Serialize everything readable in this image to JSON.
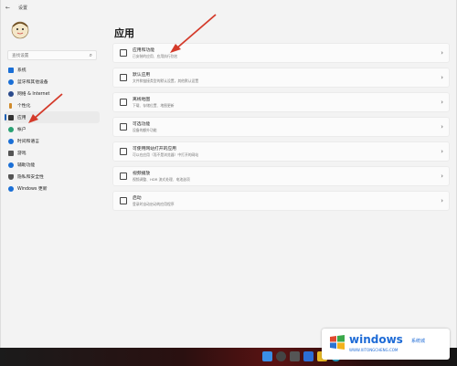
{
  "window": {
    "title": "设置"
  },
  "search": {
    "placeholder": "查找设置"
  },
  "sidebar": {
    "items": [
      {
        "label": "系统",
        "icon": "display-icon",
        "color": "#1a6fd6"
      },
      {
        "label": "蓝牙和其他设备",
        "icon": "bluetooth-icon",
        "color": "#1a6fd6"
      },
      {
        "label": "网络 & Internet",
        "icon": "network-icon",
        "color": "#2b4b8c"
      },
      {
        "label": "个性化",
        "icon": "brush-icon",
        "color": "#d08a2b"
      },
      {
        "label": "应用",
        "icon": "apps-icon",
        "color": "#333333",
        "active": true
      },
      {
        "label": "帐户",
        "icon": "account-icon",
        "color": "#2aa173"
      },
      {
        "label": "时间和语言",
        "icon": "globe-icon",
        "color": "#1a6fd6"
      },
      {
        "label": "游戏",
        "icon": "gamepad-icon",
        "color": "#555555"
      },
      {
        "label": "辅助功能",
        "icon": "accessibility-icon",
        "color": "#1a6fd6"
      },
      {
        "label": "隐私和安全性",
        "icon": "shield-icon",
        "color": "#555555"
      },
      {
        "label": "Windows 更新",
        "icon": "update-icon",
        "color": "#1a6fd6"
      }
    ]
  },
  "main": {
    "title": "应用",
    "rows": [
      {
        "title": "应用和功能",
        "subtitle": "已安装的应用、应用执行别名"
      },
      {
        "title": "默认应用",
        "subtitle": "文件和链接类型的默认设置，其他默认设置"
      },
      {
        "title": "离线地图",
        "subtitle": "下载、存储位置、地图更新"
      },
      {
        "title": "可选功能",
        "subtitle": "设备的额外功能"
      },
      {
        "title": "可使用网站打开的应用",
        "subtitle": "可以在应用（而不是浏览器）中打开的网站"
      },
      {
        "title": "视频播放",
        "subtitle": "视频调整、HDR 流式处理、电池选项"
      },
      {
        "title": "启动",
        "subtitle": "登录时自动启动的应用程序"
      }
    ]
  },
  "watermark": {
    "main": "windows",
    "cn": "系统城",
    "sub": "WWW.XITONGCHENG.COM"
  },
  "colors": {
    "accent": "#1a5fb4",
    "arrow": "#d43a2a",
    "watermark": "#1e6bd6"
  }
}
